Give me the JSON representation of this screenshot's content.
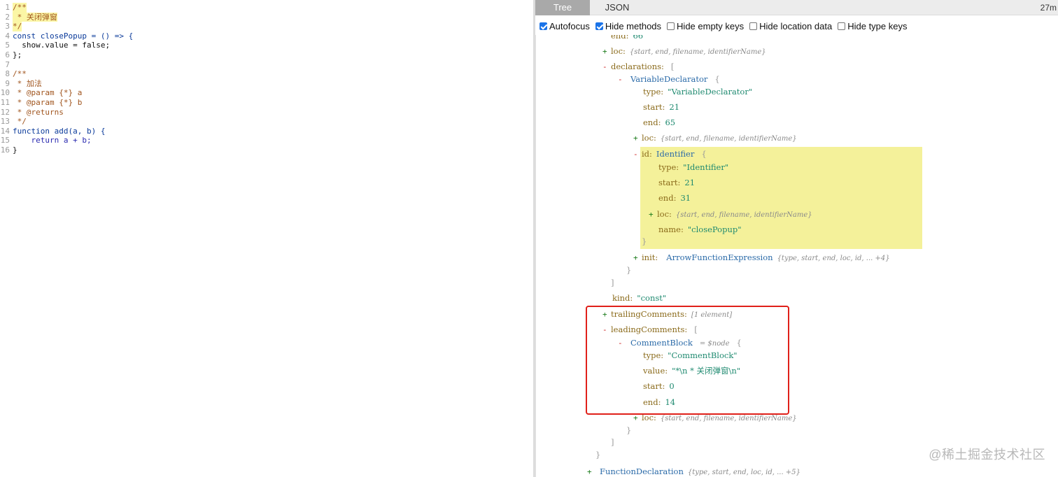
{
  "editor": {
    "lines": [
      {
        "n": "1",
        "text": "/**"
      },
      {
        "n": "2",
        "text": " * 关闭弹窗"
      },
      {
        "n": "3",
        "text": "*/"
      },
      {
        "n": "4",
        "text": "const closePopup = () => {"
      },
      {
        "n": "5",
        "text": "  show.value = false;"
      },
      {
        "n": "6",
        "text": "};"
      },
      {
        "n": "7",
        "text": ""
      },
      {
        "n": "8",
        "text": "/**"
      },
      {
        "n": "9",
        "text": " * 加法"
      },
      {
        "n": "10",
        "text": " * @param {*} a"
      },
      {
        "n": "11",
        "text": " * @param {*} b"
      },
      {
        "n": "12",
        "text": " * @returns"
      },
      {
        "n": "13",
        "text": " */"
      },
      {
        "n": "14",
        "text": "function add(a, b) {"
      },
      {
        "n": "15",
        "text": "    return a + b;"
      },
      {
        "n": "16",
        "text": "}"
      }
    ]
  },
  "panel": {
    "tabs": {
      "tree": "Tree",
      "json": "JSON"
    },
    "time": "27m",
    "options": {
      "autofocus": "Autofocus",
      "hide_methods": "Hide methods",
      "hide_empty": "Hide empty keys",
      "hide_location": "Hide location data",
      "hide_type": "Hide type keys"
    }
  },
  "tree": {
    "r0": {
      "key": "end:",
      "val": "66"
    },
    "r1": {
      "toggle": "+",
      "key": "loc:",
      "summary": "{start, end, filename, identifierName}"
    },
    "r2": {
      "toggle": "-",
      "key": "declarations:",
      "bracket": "["
    },
    "r3": {
      "toggle": "-",
      "type": "VariableDeclarator",
      "bracket": "{"
    },
    "r4": {
      "key": "type:",
      "val": "\"VariableDeclarator\""
    },
    "r5": {
      "key": "start:",
      "val": "21"
    },
    "r6": {
      "key": "end:",
      "val": "65"
    },
    "r7": {
      "toggle": "+",
      "key": "loc:",
      "summary": "{start, end, filename, identifierName}"
    },
    "r8": {
      "toggle": "-",
      "key": "id:",
      "type": "Identifier",
      "bracket": "{"
    },
    "r9": {
      "key": "type:",
      "val": "\"Identifier\""
    },
    "r10": {
      "key": "start:",
      "val": "21"
    },
    "r11": {
      "key": "end:",
      "val": "31"
    },
    "r12": {
      "toggle": "+",
      "key": "loc:",
      "summary": "{start, end, filename, identifierName}"
    },
    "r13": {
      "key": "name:",
      "val": "\"closePopup\""
    },
    "r14": {
      "close": "}"
    },
    "r15": {
      "toggle": "+",
      "key": "init:",
      "type": "ArrowFunctionExpression",
      "summary": "{type, start, end, loc, id, ... +4}"
    },
    "r16": {
      "close": "}"
    },
    "r17": {
      "close": "]"
    },
    "r18": {
      "key": "kind:",
      "val": "\"const\""
    },
    "r19": {
      "toggle": "+",
      "key": "trailingComments:",
      "summary": "[1 element]"
    },
    "r20": {
      "toggle": "-",
      "key": "leadingComments:",
      "bracket": "["
    },
    "r21": {
      "toggle": "-",
      "type": "CommentBlock",
      "dollar": "= $node",
      "bracket": "{"
    },
    "r22": {
      "key": "type:",
      "val": "\"CommentBlock\""
    },
    "r23": {
      "key": "value:",
      "val": "\"*\\n * 关闭弹窗\\n\""
    },
    "r24": {
      "key": "start:",
      "val": "0"
    },
    "r25": {
      "key": "end:",
      "val": "14"
    },
    "r26": {
      "toggle": "+",
      "key": "loc:",
      "summary": "{start, end, filename, identifierName}"
    },
    "r27": {
      "close": "}"
    },
    "r28": {
      "close": "]"
    },
    "r29": {
      "close": "}"
    },
    "r30": {
      "toggle": "+",
      "type": "FunctionDeclaration",
      "summary": "{type, start, end, loc, id, ... +5}"
    }
  },
  "watermark": "@稀土掘金技术社区",
  "colors": {
    "highlight": "#f4f19a",
    "red_box": "#e0201a",
    "tab_active": "#a9a9a9"
  }
}
